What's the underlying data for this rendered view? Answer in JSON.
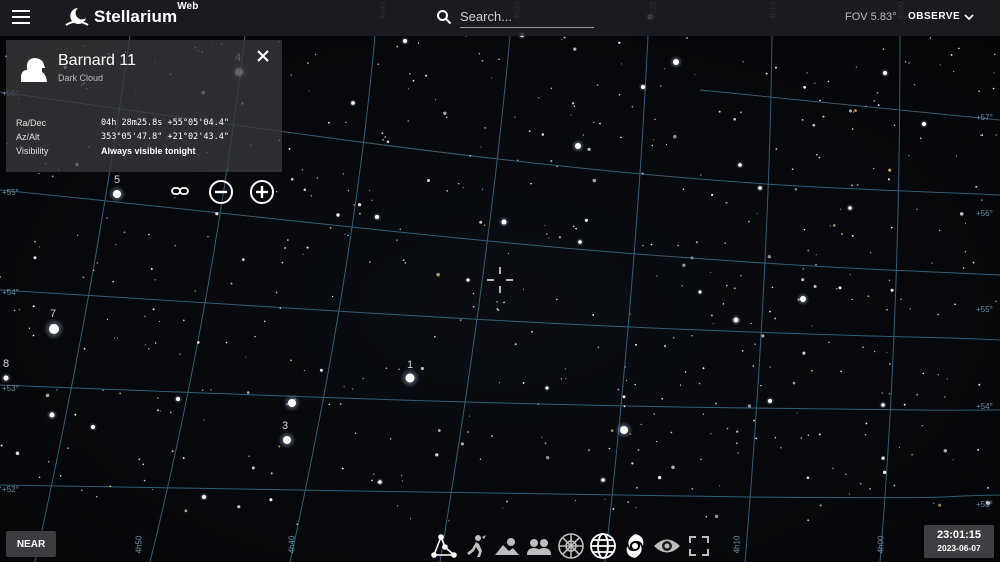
{
  "app": {
    "name": "Stellarium",
    "name_sup": "Web"
  },
  "search": {
    "placeholder": "Search..."
  },
  "fov": "FOV 5.83°",
  "observe_label": "OBSERVE",
  "info": {
    "name": "Barnard 11",
    "type": "Dark Cloud",
    "rows": [
      {
        "label": "Ra/Dec",
        "value": "04h  28m25.8s  +55°05'04.4\""
      },
      {
        "label": "Az/Alt",
        "value": "353°05'47.8\"  +21°02'43.4\""
      },
      {
        "label": "Visibility",
        "value": "Always visible tonight"
      }
    ]
  },
  "star_labels": [
    "4",
    "5",
    "7",
    "8",
    "1",
    "3"
  ],
  "grid_labels": [
    "+56°",
    "+55°",
    "+54°",
    "+53°",
    "+52°",
    "+57°",
    "+56°",
    "+55°",
    "+54°",
    "+53°",
    "4h40",
    "4h30",
    "4h20",
    "4h10",
    "4h00",
    "4h50",
    "4h40",
    "4h10",
    "4h00"
  ],
  "near_label": "NEAR",
  "clock": {
    "time": "23:01:15",
    "date": "2023-06-07"
  },
  "toolbar_icons": [
    "constellation-lines-icon",
    "constellation-art-icon",
    "landscape-icon",
    "atmosphere-icon",
    "azimuthal-grid-icon",
    "equatorial-grid-icon",
    "deep-sky-objects-icon",
    "night-mode-icon",
    "fullscreen-icon"
  ],
  "colors": {
    "grid": "#3c6e8a",
    "panel": "#3a3a3e",
    "sky": "#06080c"
  }
}
